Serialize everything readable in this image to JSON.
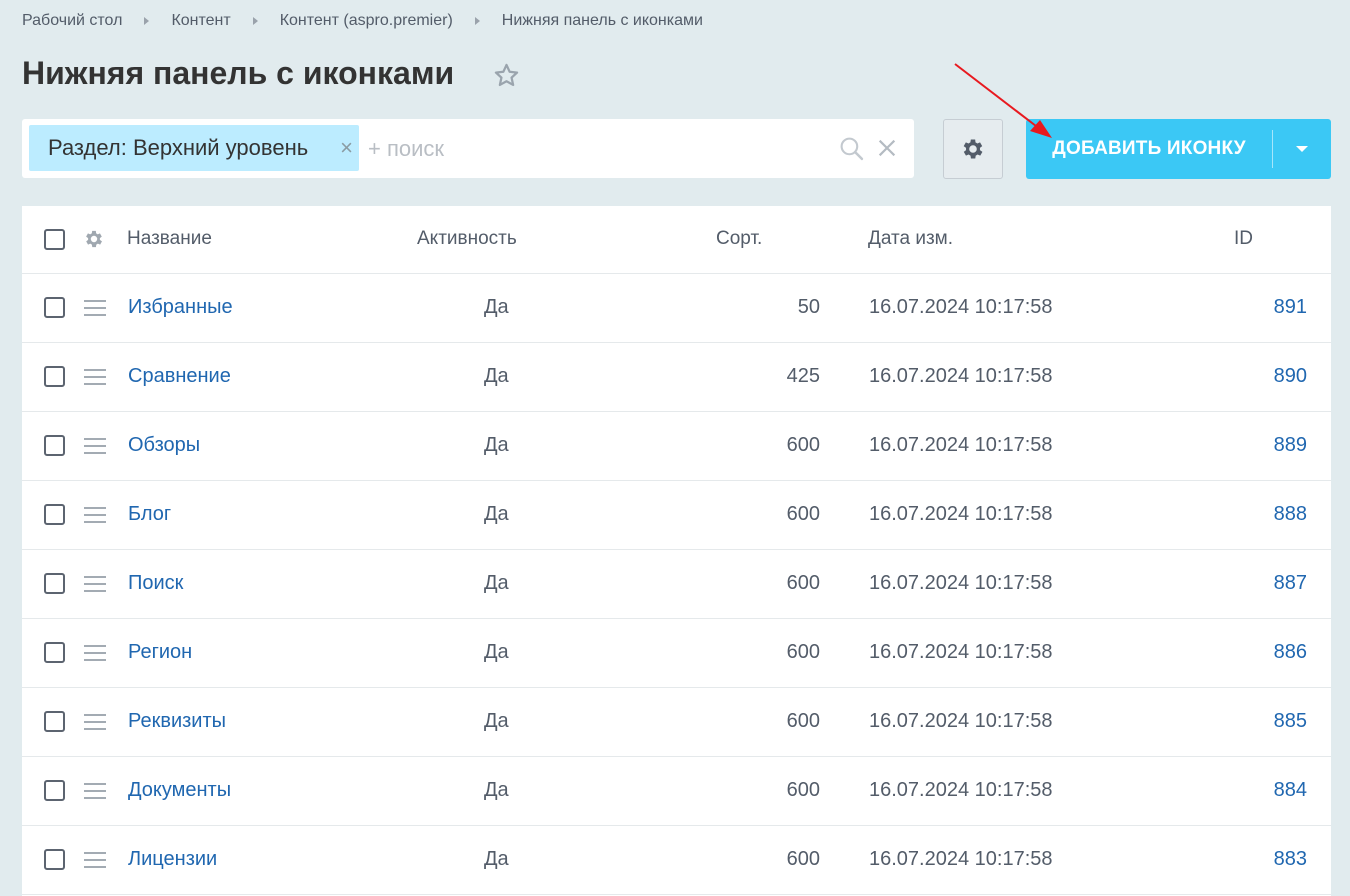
{
  "breadcrumb": [
    "Рабочий стол",
    "Контент",
    "Контент (aspro.premier)",
    "Нижняя панель с иконками"
  ],
  "page_title": "Нижняя панель с иконками",
  "filter": {
    "tag_label": "Раздел: Верхний уровень",
    "search_placeholder": "+ поиск"
  },
  "add_button_label": "ДОБАВИТЬ ИКОНКУ",
  "table": {
    "headers": {
      "name": "Название",
      "active": "Активность",
      "sort": "Сорт.",
      "date": "Дата изм.",
      "id": "ID"
    },
    "rows": [
      {
        "name": "Избранные",
        "active": "Да",
        "sort": "50",
        "date": "16.07.2024 10:17:58",
        "id": "891"
      },
      {
        "name": "Сравнение",
        "active": "Да",
        "sort": "425",
        "date": "16.07.2024 10:17:58",
        "id": "890"
      },
      {
        "name": "Обзоры",
        "active": "Да",
        "sort": "600",
        "date": "16.07.2024 10:17:58",
        "id": "889"
      },
      {
        "name": "Блог",
        "active": "Да",
        "sort": "600",
        "date": "16.07.2024 10:17:58",
        "id": "888"
      },
      {
        "name": "Поиск",
        "active": "Да",
        "sort": "600",
        "date": "16.07.2024 10:17:58",
        "id": "887"
      },
      {
        "name": "Регион",
        "active": "Да",
        "sort": "600",
        "date": "16.07.2024 10:17:58",
        "id": "886"
      },
      {
        "name": "Реквизиты",
        "active": "Да",
        "sort": "600",
        "date": "16.07.2024 10:17:58",
        "id": "885"
      },
      {
        "name": "Документы",
        "active": "Да",
        "sort": "600",
        "date": "16.07.2024 10:17:58",
        "id": "884"
      },
      {
        "name": "Лицензии",
        "active": "Да",
        "sort": "600",
        "date": "16.07.2024 10:17:58",
        "id": "883"
      }
    ]
  },
  "colors": {
    "background": "#e1ebee",
    "accent": "#3bc8f5",
    "link": "#2067b0",
    "filter_tag": "#bcecff",
    "annotation_arrow": "#e8191f"
  },
  "icons": [
    "star-icon",
    "search-icon",
    "close-icon",
    "gear-icon",
    "chevron-down-icon",
    "drag-handle-icon"
  ]
}
